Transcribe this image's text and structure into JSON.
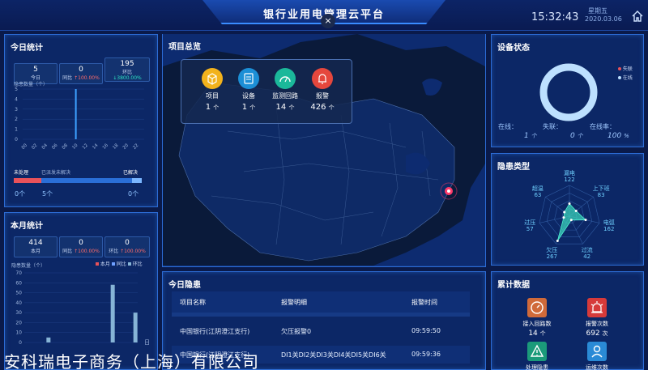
{
  "header": {
    "title": "银行业用电管理云平台",
    "time": "15:32:43",
    "weekday": "星期五",
    "date": "2020.03.06",
    "close_glyph": "×"
  },
  "today_stats": {
    "title": "今日统计",
    "boxes": [
      {
        "value": "5",
        "label": "今日",
        "delta": ""
      },
      {
        "value": "0",
        "label": "同比",
        "delta": "↑100.00%"
      },
      {
        "value": "195",
        "label": "环比",
        "delta": "↓3800.00%"
      }
    ],
    "chart_label": "隐患数量（个）",
    "y_ticks": [
      "5",
      "4",
      "3",
      "2",
      "1",
      "0"
    ],
    "x_ticks": [
      "00",
      "02",
      "04",
      "06",
      "08",
      "10",
      "12",
      "14",
      "16",
      "18",
      "20",
      "22"
    ],
    "progress": {
      "unhandled_label": "未处理",
      "sent_label": "已派发未解决",
      "resolved_label": "已解决",
      "unhandled_count": "0个",
      "sent_count": "5个",
      "resolved_count": "0个",
      "sent_fraction": 0.9
    }
  },
  "chart_data": [
    {
      "type": "bar",
      "title": "",
      "ylabel": "隐患数量（个）",
      "categories": [
        "00",
        "02",
        "04",
        "06",
        "08",
        "10",
        "12",
        "14",
        "16",
        "18",
        "20",
        "22"
      ],
      "hours": [
        0,
        1,
        2,
        3,
        4,
        5,
        6,
        7,
        8,
        9,
        10,
        11,
        12,
        13,
        14,
        15,
        16,
        17,
        18,
        19,
        20,
        21,
        22,
        23
      ],
      "values": [
        0,
        0,
        0,
        0,
        0,
        0,
        0,
        0,
        0,
        0,
        5,
        0,
        0,
        0,
        0,
        0,
        0,
        0,
        0,
        0,
        0,
        0,
        0,
        0
      ],
      "ylim": [
        0,
        5
      ]
    },
    {
      "type": "bar",
      "title": "",
      "ylabel": "隐患数量（个）",
      "legend": [
        "本月",
        "同比",
        "环比"
      ],
      "y_ticks": [
        "70",
        "60",
        "50",
        "40",
        "30",
        "20",
        "10",
        "0"
      ],
      "x_last": "日",
      "days": [
        1,
        2,
        3,
        4,
        5,
        6,
        7,
        8,
        9,
        10,
        11,
        12,
        13,
        14,
        15,
        16,
        17,
        18,
        19,
        20,
        21,
        22,
        23,
        24,
        25,
        26,
        27,
        28,
        29,
        30
      ],
      "series": [
        {
          "name": "本月",
          "values": [
            0,
            0,
            0,
            0,
            0,
            0,
            0,
            0,
            0,
            0,
            0,
            0,
            0,
            0,
            0,
            0,
            0,
            0,
            0,
            0,
            0,
            0,
            0,
            0,
            0,
            0,
            0,
            0,
            0,
            0
          ]
        },
        {
          "name": "同比",
          "values": [
            0,
            0,
            0,
            0,
            0,
            0,
            0,
            0,
            0,
            0,
            0,
            0,
            0,
            0,
            0,
            0,
            0,
            0,
            0,
            0,
            0,
            0,
            0,
            0,
            0,
            0,
            0,
            0,
            0,
            0
          ]
        },
        {
          "name": "环比",
          "values": [
            0,
            0,
            0,
            0,
            0,
            5,
            0,
            0,
            0,
            0,
            0,
            0,
            0,
            0,
            0,
            0,
            0,
            0,
            0,
            0,
            0,
            0,
            58,
            0,
            0,
            0,
            0,
            0,
            30,
            0
          ]
        }
      ],
      "ylim": [
        0,
        70
      ]
    },
    {
      "type": "radar",
      "title": "隐患类型",
      "axes": [
        {
          "label": "漏电",
          "value": 122
        },
        {
          "label": "上下班",
          "value": 83
        },
        {
          "label": "电弧",
          "value": 162
        },
        {
          "label": "过流",
          "value": 42
        },
        {
          "label": "欠压",
          "value": 267
        },
        {
          "label": "过压",
          "value": 57
        },
        {
          "label": "超温",
          "value": 63
        }
      ],
      "max": 300
    }
  ],
  "month_stats": {
    "title": "本月统计",
    "boxes": [
      {
        "value": "414",
        "label": "本月",
        "delta": ""
      },
      {
        "value": "0",
        "label": "同比",
        "delta": "↑100.00%"
      },
      {
        "value": "0",
        "label": "环比",
        "delta": "↑100.00%"
      }
    ],
    "chart_label": "隐患数量（个）",
    "legend": [
      "本月",
      "同比",
      "环比"
    ]
  },
  "overview": {
    "title": "项目总览",
    "items": [
      {
        "label": "项目",
        "value": "1",
        "unit": "个"
      },
      {
        "label": "设备",
        "value": "1",
        "unit": "个"
      },
      {
        "label": "监测回路",
        "value": "14",
        "unit": "个"
      },
      {
        "label": "报警",
        "value": "426",
        "unit": "个"
      }
    ]
  },
  "device_status": {
    "title": "设备状态",
    "legend": [
      "失联",
      "在线"
    ],
    "online_label": "在线：",
    "online_value": "1",
    "lost_label": "失联：",
    "lost_value": "0",
    "rate_label": "在线率：",
    "rate_value": "100",
    "unit_ge": "个",
    "unit_pct": "%",
    "online_fraction": 1.0
  },
  "risk_type": {
    "title": "隐患类型"
  },
  "today_risk": {
    "title": "今日隐患",
    "headers": [
      "项目名称",
      "报警明细",
      "报警时间"
    ],
    "rows": [
      {
        "name": "中国银行(江阴澄江支行)",
        "detail": "欠压报警0",
        "time": "09:59:50"
      },
      {
        "name": "中国银行(江阴澄江支行)",
        "detail": "DI1关DI2关DI3关DI4关DI5关DI6关",
        "time": "09:59:36"
      }
    ]
  },
  "cumulative": {
    "title": "累计数据",
    "items": [
      {
        "label": "接入回路数",
        "value": "14",
        "unit": "个"
      },
      {
        "label": "报警次数",
        "value": "692",
        "unit": "次"
      },
      {
        "label": "处理隐患",
        "value": "",
        "unit": ""
      },
      {
        "label": "运维次数",
        "value": "",
        "unit": ""
      }
    ]
  },
  "watermark": "安科瑞电子商务（上海）有限公司"
}
